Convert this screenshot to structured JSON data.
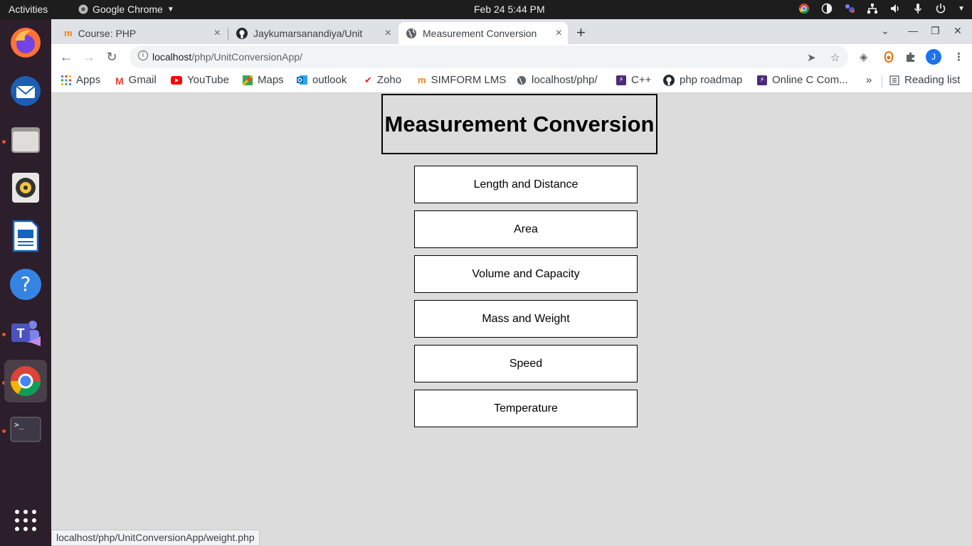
{
  "topbar": {
    "activities": "Activities",
    "app_name": "Google Chrome",
    "clock": "Feb 24  5:44 PM"
  },
  "tabs": [
    {
      "title": "Course: PHP",
      "close": "×"
    },
    {
      "title": "Jaykumarsanandiya/Unit",
      "close": "×"
    },
    {
      "title": "Measurement Conversion",
      "close": "×"
    }
  ],
  "newtab": "+",
  "address": {
    "host": "localhost",
    "path": "/php/UnitConversionApp/"
  },
  "avatar_letter": "J",
  "bookmarks": [
    {
      "label": "Apps",
      "color": "#4285f4"
    },
    {
      "label": "Gmail",
      "color": "#ea4335"
    },
    {
      "label": "YouTube",
      "color": "#ff0000"
    },
    {
      "label": "Maps",
      "color": "#34a853"
    },
    {
      "label": "outlook",
      "color": "#0072c6"
    },
    {
      "label": "Zoho",
      "color": "#e42527"
    },
    {
      "label": "SIMFORM LMS",
      "color": "#f98012"
    },
    {
      "label": "localhost/php/",
      "color": "#5f6368"
    },
    {
      "label": "C++",
      "color": "#4b2a77"
    },
    {
      "label": "php roadmap",
      "color": "#24292e"
    },
    {
      "label": "Online C Com...",
      "color": "#4b2a77"
    }
  ],
  "bookmarks_overflow": "»",
  "reading_list": "Reading list",
  "page": {
    "title": "Measurement Conversion",
    "buttons": [
      "Length and Distance",
      "Area",
      "Volume and Capacity",
      "Mass and Weight",
      "Speed",
      "Temperature"
    ]
  },
  "status_url": "localhost/php/UnitConversionApp/weight.php"
}
